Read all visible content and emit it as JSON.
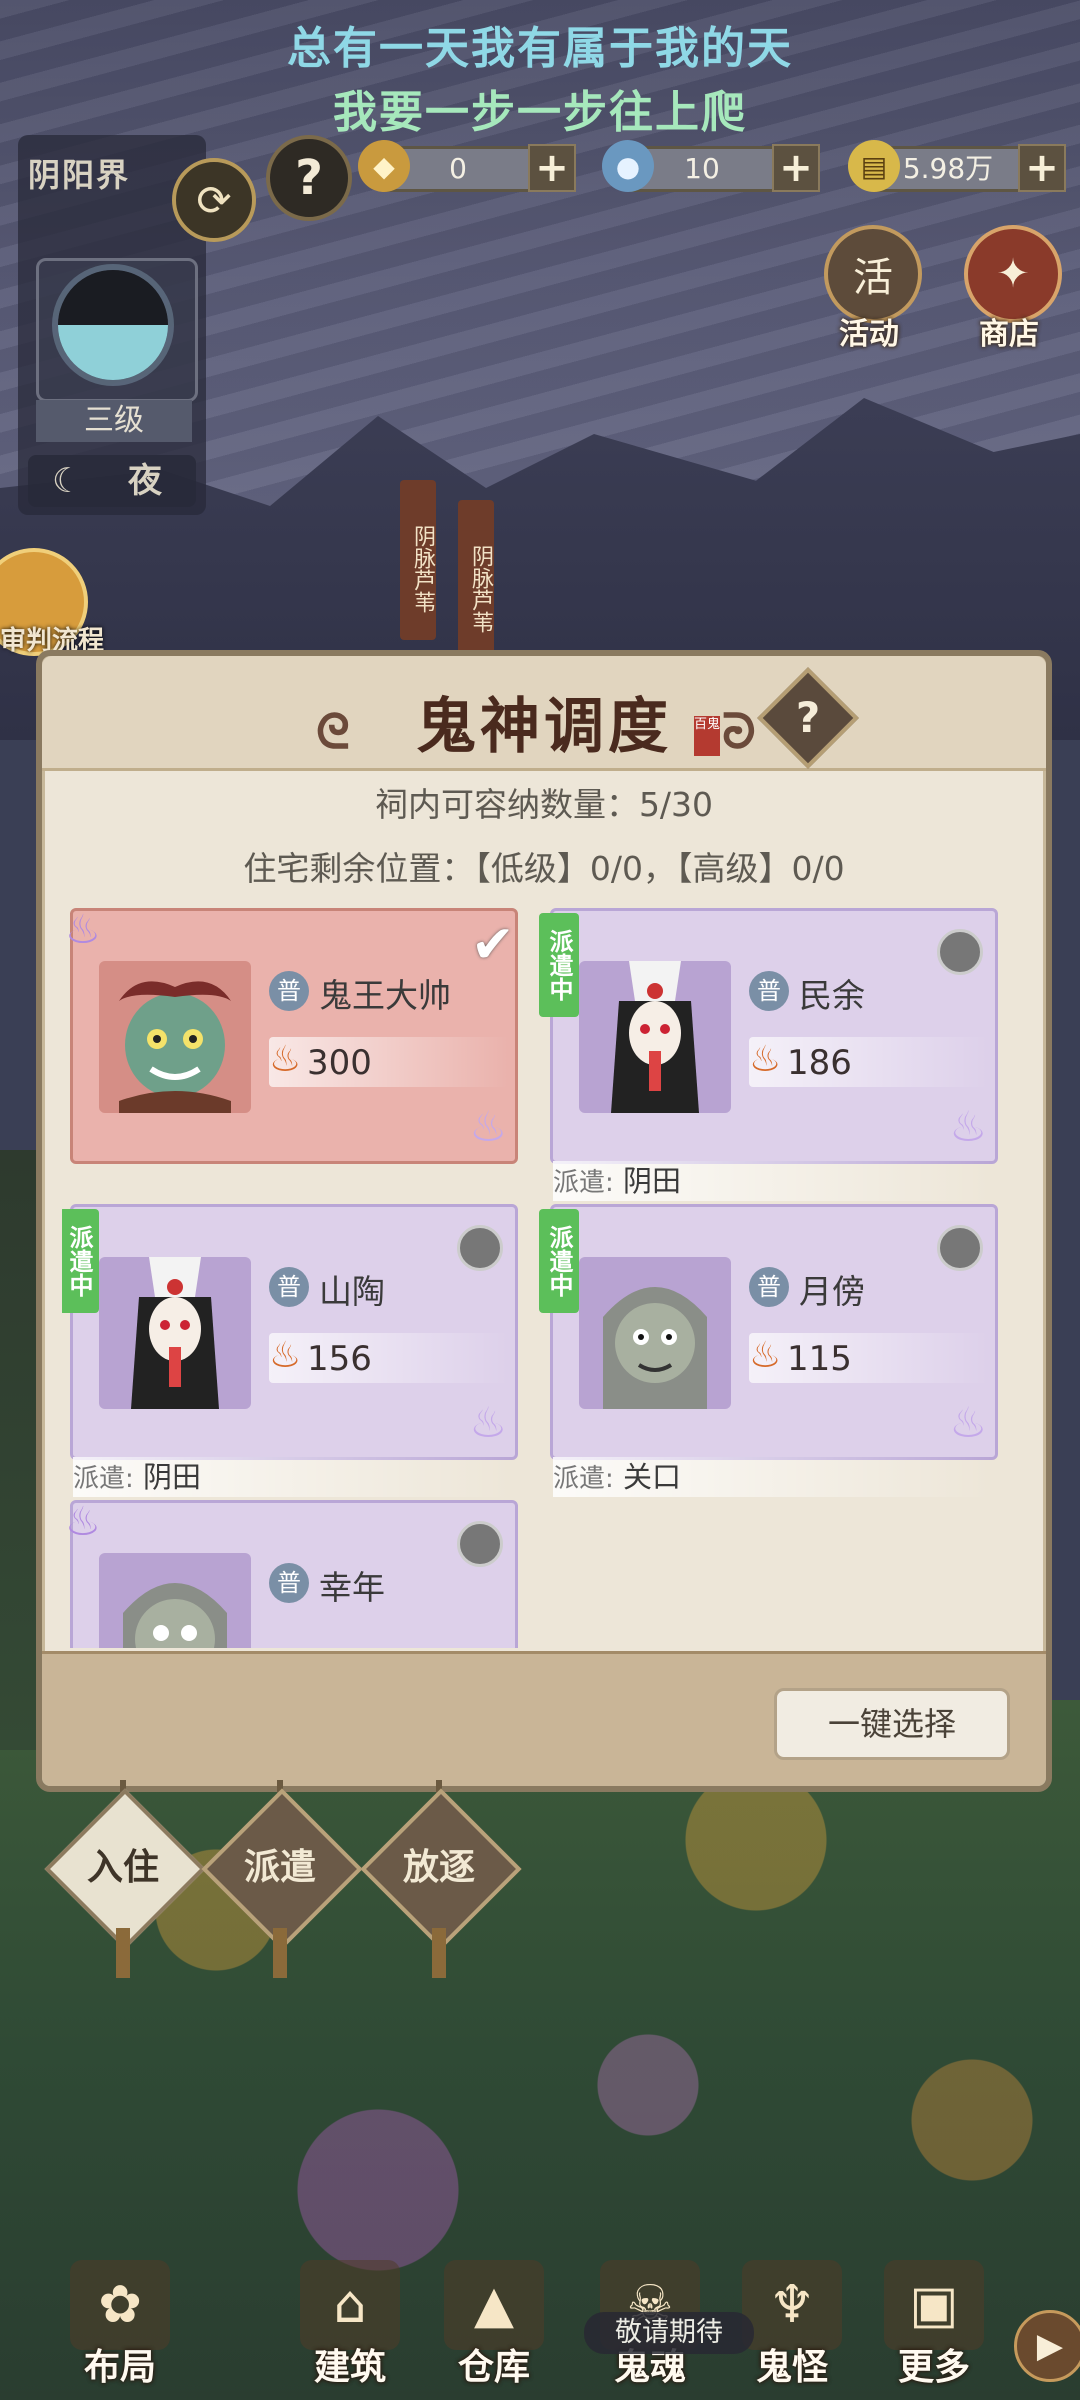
{
  "lyrics": {
    "line1": "总有一天我有属于我的天",
    "line2": "我要一步一步往上爬"
  },
  "realm": {
    "title": "阴阳界",
    "level": "三级",
    "time_of_day": "夜",
    "refresh_icon": "refresh-icon",
    "help_icon": "help-icon"
  },
  "judge": {
    "label": "审判流程"
  },
  "resources": [
    {
      "icon": "gold-ingot-icon",
      "value": "0"
    },
    {
      "icon": "spirit-orb-icon",
      "value": "10"
    },
    {
      "icon": "coin-scroll-icon",
      "value": "5.98万"
    }
  ],
  "corner_buttons": {
    "activity": "活动",
    "activity_glyph": "活",
    "shop": "商店"
  },
  "signs": [
    "阴脉芦苇",
    "阴脉芦苇"
  ],
  "dialog": {
    "title": "鬼神调度",
    "seal": "百鬼",
    "capacity_line": "祠内可容纳数量：5/30",
    "housing_line": "住宅剩余位置：【低级】0/0，【高级】0/0",
    "select_all": "一键选择",
    "cards": [
      {
        "name": "鬼王大帅",
        "rank": "普",
        "power": "300",
        "selected": true,
        "dispatched": false,
        "location": ""
      },
      {
        "name": "民余",
        "rank": "普",
        "power": "186",
        "selected": false,
        "dispatched": true,
        "location": "阴田"
      },
      {
        "name": "山陶",
        "rank": "普",
        "power": "156",
        "selected": false,
        "dispatched": true,
        "location": "阴田"
      },
      {
        "name": "月傍",
        "rank": "普",
        "power": "115",
        "selected": false,
        "dispatched": true,
        "location": "关口"
      },
      {
        "name": "幸年",
        "rank": "普",
        "power": "",
        "selected": false,
        "dispatched": false,
        "location": ""
      }
    ],
    "dispatch_tag": "派遣中",
    "location_prefix": "派遣:"
  },
  "actions": [
    "入住",
    "派遣",
    "放逐"
  ],
  "bottom_nav": [
    {
      "label": "布局",
      "icon": "layout-icon"
    },
    {
      "label": "建筑",
      "icon": "building-icon"
    },
    {
      "label": "仓库",
      "icon": "warehouse-icon"
    },
    {
      "label": "鬼魂",
      "icon": "ghost-icon"
    },
    {
      "label": "鬼怪",
      "icon": "monster-icon"
    },
    {
      "label": "更多",
      "icon": "more-icon"
    }
  ],
  "coming_soon": "敬请期待",
  "colors": {
    "selected_card": "#eab2ac",
    "card": "#ddd0ea",
    "dispatch_tag": "#5cbf5a"
  }
}
